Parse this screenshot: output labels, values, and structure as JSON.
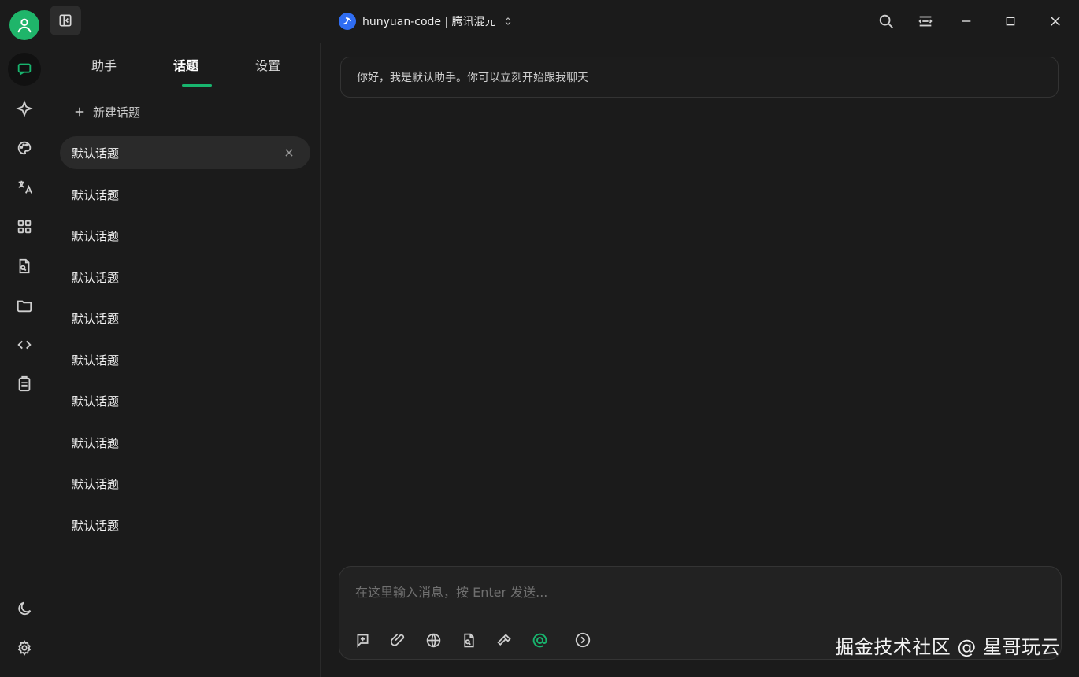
{
  "header": {
    "model_name": "hunyuan-code | 腾讯混元"
  },
  "rail": {
    "items": [
      {
        "icon": "chat-bubble-icon"
      },
      {
        "icon": "sparkle-icon"
      },
      {
        "icon": "palette-icon"
      },
      {
        "icon": "translate-icon"
      },
      {
        "icon": "apps-grid-icon"
      },
      {
        "icon": "document-search-icon"
      },
      {
        "icon": "folder-icon"
      },
      {
        "icon": "code-icon"
      },
      {
        "icon": "clipboard-icon"
      }
    ],
    "bottom_items": [
      {
        "icon": "moon-icon"
      },
      {
        "icon": "gear-icon"
      }
    ]
  },
  "topic_panel": {
    "tabs": [
      {
        "label": "助手"
      },
      {
        "label": "话题"
      },
      {
        "label": "设置"
      }
    ],
    "new_topic_label": "新建话题",
    "topics": [
      {
        "label": "默认话题"
      },
      {
        "label": "默认话题"
      },
      {
        "label": "默认话题"
      },
      {
        "label": "默认话题"
      },
      {
        "label": "默认话题"
      },
      {
        "label": "默认话题"
      },
      {
        "label": "默认话题"
      },
      {
        "label": "默认话题"
      },
      {
        "label": "默认话题"
      },
      {
        "label": "默认话题"
      }
    ]
  },
  "chat": {
    "welcome_message": "你好，我是默认助手。你可以立刻开始跟我聊天",
    "input_placeholder": "在这里输入消息，按 Enter 发送..."
  },
  "watermark": "掘金技术社区 @ 星哥玩云",
  "colors": {
    "accent": "#18b56e",
    "background": "#1b1b1b",
    "panel": "#222222"
  }
}
